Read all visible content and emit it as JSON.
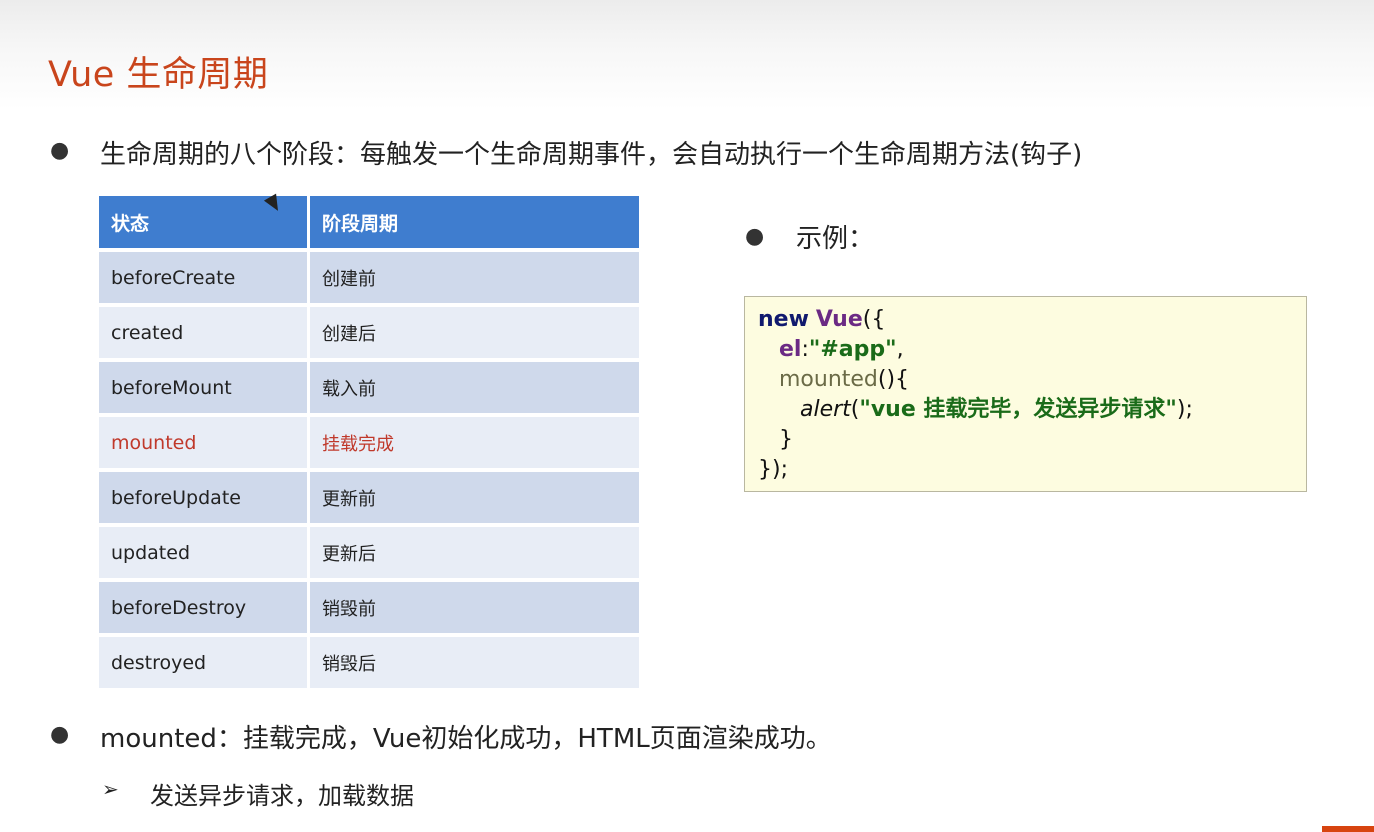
{
  "slide": {
    "title": "Vue 生命周期",
    "bullet1": "生命周期的八个阶段：每触发一个生命周期事件，会自动执行一个生命周期方法(钩子)",
    "example_label": "示例：",
    "bullet3": "mounted：挂载完成，Vue初始化成功，HTML页面渲染成功。",
    "sub_bullet": "发送异步请求，加载数据",
    "bullet_glyph": "●",
    "arrow_glyph": "➢"
  },
  "table": {
    "headers": [
      "状态",
      "阶段周期"
    ],
    "rows": [
      {
        "state": "beforeCreate",
        "phase": "创建前"
      },
      {
        "state": "created",
        "phase": "创建后"
      },
      {
        "state": "beforeMount",
        "phase": "载入前"
      },
      {
        "state": "mounted",
        "phase": "挂载完成"
      },
      {
        "state": "beforeUpdate",
        "phase": "更新前"
      },
      {
        "state": "updated",
        "phase": "更新后"
      },
      {
        "state": "beforeDestroy",
        "phase": "销毁前"
      },
      {
        "state": "destroyed",
        "phase": "销毁后"
      }
    ]
  },
  "code": {
    "line1_kw": "new",
    "line1_cls": "Vue",
    "line1_end": "({",
    "line2_prop": "el",
    "line2_colon": ":",
    "line2_str": "\"#app\"",
    "line2_end": ",",
    "line3_meth": "mounted",
    "line3_end": "(){",
    "line4_fn": "alert",
    "line4_open": "(",
    "line4_str": "\"vue 挂载完毕，发送异步请求\"",
    "line4_end": ");",
    "line5": "}",
    "line6": "});"
  },
  "colors": {
    "title": "#c9451c",
    "table_header": "#3f7dcf",
    "row_dark": "#cfd9eb",
    "row_light": "#e8edf6",
    "highlight": "#c0392b",
    "code_bg": "#fdfce0"
  }
}
